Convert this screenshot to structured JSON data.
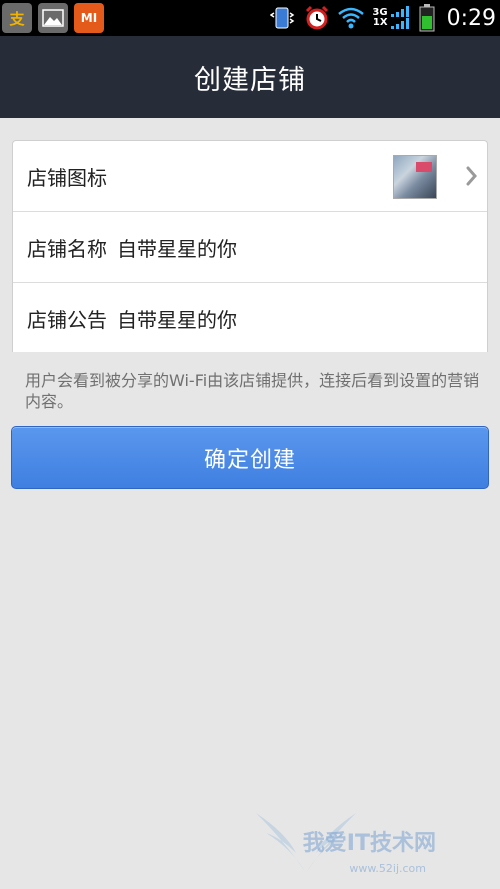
{
  "status_bar": {
    "time": "0:29",
    "network_top": "3G",
    "network_bottom": "1X",
    "notification_icons": [
      "alipay-icon",
      "gallery-icon",
      "mi-icon"
    ],
    "mi_label": "MI"
  },
  "header": {
    "title": "创建店铺"
  },
  "form": {
    "icon_row": {
      "label": "店铺图标"
    },
    "name_row": {
      "label": "店铺名称",
      "value": "自带星星的你"
    },
    "notice_row": {
      "label": "店铺公告",
      "value": "自带星星的你"
    }
  },
  "hint_text": "用户会看到被分享的Wi-Fi由该店铺提供，连接后看到设置的营销内容。",
  "primary_button": {
    "label": "确定创建"
  },
  "watermark": {
    "text": "我爱IT技术网",
    "url": "www.52ij.com"
  },
  "colors": {
    "header_bg": "#262c38",
    "page_bg": "#e6e6e6",
    "button_blue": "#4a88e6",
    "battery_green": "#2fbf2f"
  }
}
